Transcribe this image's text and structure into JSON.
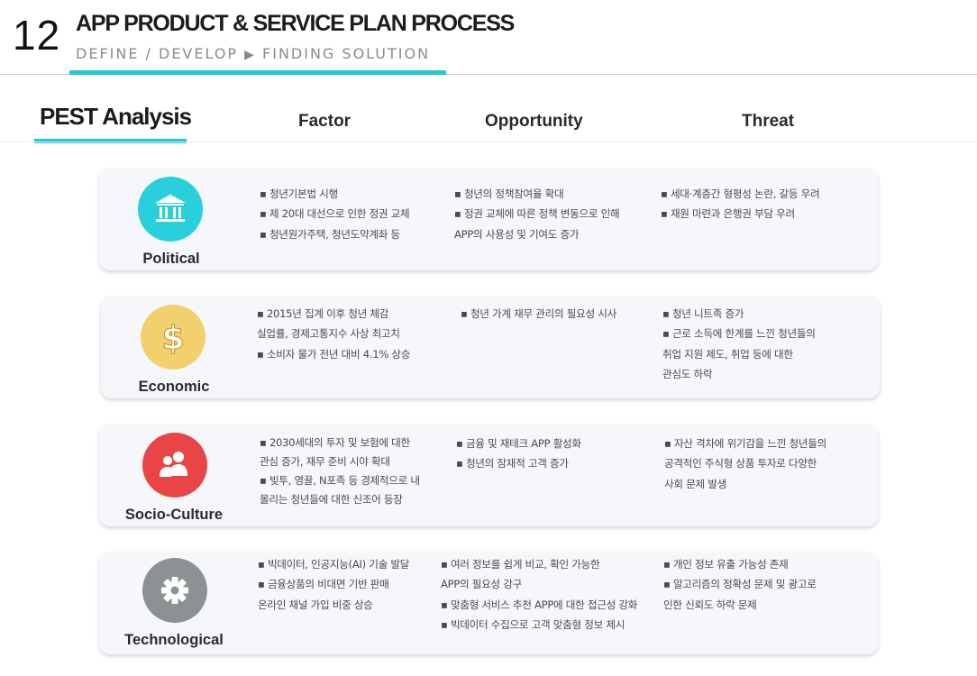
{
  "header": {
    "page_number": "12",
    "title": "APP PRODUCT & SERVICE PLAN PROCESS",
    "subtitle_left": "DEFINE / DEVELOP",
    "subtitle_arrow": "▶",
    "subtitle_right": "FINDING SOLUTION"
  },
  "pest": {
    "title": "PEST Analysis",
    "columns": {
      "factor": "Factor",
      "opportunity": "Opportunity",
      "threat": "Threat"
    }
  },
  "colors": {
    "accent": "#27c7d6",
    "political": "#29d0dc",
    "economic": "#f2d06e",
    "socio": "#e84646",
    "technological": "#8c9294"
  },
  "rows": [
    {
      "label": "Political",
      "icon": "bank-icon",
      "factor": [
        "▪ 청년기본법 시행",
        "▪ 제 20대 대선으로 인한 정권 교체",
        "▪ 청년원가주택, 청년도약계좌 등"
      ],
      "opportunity": [
        " ▪ 청년의 정책참여율 확대",
        " ▪ 정권 교체에 따른 정책 변동으로 인해",
        "APP의 사용성 및 기여도 증가"
      ],
      "threat": [
        "▪ 세대·계층간 형평성 논란, 갈등 우려",
        "▪ 재원 마련과 은행권 부담 우려"
      ]
    },
    {
      "label": "Economic",
      "icon": "dollar-icon",
      "factor": [
        " ▪ 2015년 집계 이후 청년 체감",
        "실업률, 경제고통지수 사상 최고치",
        " ▪ 소비자 물가 전년 대비 4.1% 상승"
      ],
      "opportunity": [
        "▪ 청년 가계 재무 관리의 필요성 시사"
      ],
      "threat": [
        " ▪ 청년 니트족 증가",
        " ▪ 근로 소득에 한계를 느낀 청년들의",
        "취업 지원 제도, 취업 등에 대한",
        "관심도 하락"
      ]
    },
    {
      "label": "Socio-Culture",
      "icon": "people-icon",
      "factor": [
        "▪ 2030세대의 투자 및 보험에 대한",
        "관심 증가, 재무 준비 시야 확대",
        "▪ 빚투, 영끌, N포족 등 경제적으로 내",
        "몰리는 청년들에 대한 신조어 등장"
      ],
      "opportunity": [
        " ▪ 금융 및 재테크 APP 활성화",
        " ▪ 청년의 잠재적 고객 증가"
      ],
      "threat": [
        "▪ 자산 격차에 위기감을 느낀 청년들의",
        "공격적인 주식형 상품 투자로 다양한",
        "사회 문제 발생"
      ]
    },
    {
      "label": "Technological",
      "icon": "gear-icon",
      "factor": [
        "▪ 빅데이터, 인공지능(AI) 기술 발달",
        "▪ 금융상품의 비대면 기반 판매",
        "온라인 채널 가입 비중 상승"
      ],
      "opportunity": [
        "▪ 여러 정보를 쉽게 비교, 확인 가능한",
        " APP의 필요성 강구",
        " ▪ 맞춤형 서비스 추천 APP에 대한 접근성 강화",
        " ▪ 빅데이터 수집으로 고객 맞춤형 정보 제시"
      ],
      "threat": [
        "▪ 개인 정보 유출 가능성 존재",
        "▪ 알고리즘의 정확성 문제 및 광고로",
        "인한 신뢰도 하락 문제"
      ]
    }
  ]
}
